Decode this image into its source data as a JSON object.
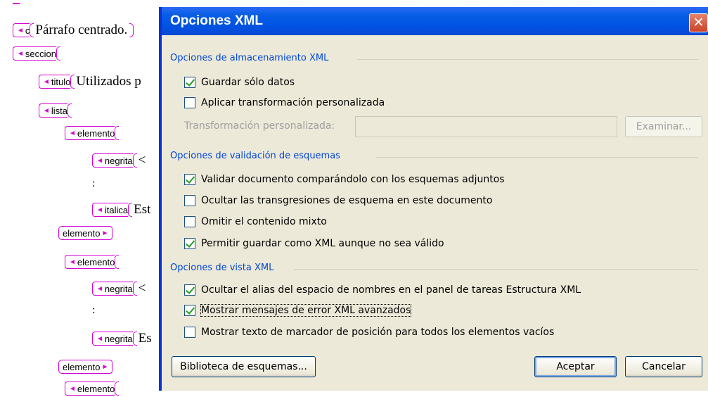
{
  "document": {
    "c_tag": "c",
    "c_text": "Párrafo centrado.",
    "seccion_tag": "seccion",
    "titulo_tag": "titulo",
    "titulo_text": "Utilizados p",
    "lista_tag": "lista",
    "elemento_tag": "elemento",
    "negrita_tag": "negrita",
    "italica_tag": "italica",
    "negrita1_text": "<",
    "italica_text": "Est",
    "negrita2_text": "<",
    "negrita3_text": "Es",
    "colon": ":"
  },
  "dialog": {
    "title": "Opciones XML",
    "close_glyph": "✕",
    "storage": {
      "title": "Opciones de almacenamiento XML",
      "save_data_only": {
        "label": "Guardar sólo datos",
        "checked": true
      },
      "apply_transform": {
        "label": "Aplicar transformación personalizada",
        "checked": false
      },
      "transform_label": "Transformación personalizada:",
      "transform_value": "",
      "browse_label": "Examinar..."
    },
    "validation": {
      "title": "Opciones de validación de esquemas",
      "validate": {
        "label": "Validar documento comparándolo con los esquemas adjuntos",
        "checked": true
      },
      "hide_violations": {
        "label": "Ocultar las transgresiones de esquema en este documento",
        "checked": false
      },
      "ignore_mixed": {
        "label": "Omitir el contenido mixto",
        "checked": false
      },
      "allow_save_invalid": {
        "label": "Permitir guardar como XML aunque no sea válido",
        "checked": true
      }
    },
    "view": {
      "title": "Opciones de vista XML",
      "hide_alias": {
        "label": "Ocultar el alias del espacio de nombres en el panel de tareas Estructura XML",
        "checked": true
      },
      "advanced_errors": {
        "label": "Mostrar mensajes de error XML avanzados",
        "checked": true
      },
      "placeholder_text": {
        "label": "Mostrar texto de marcador de posición para todos los elementos vacíos",
        "checked": false
      }
    },
    "schema_library_label": "Biblioteca de esquemas...",
    "ok_label": "Aceptar",
    "cancel_label": "Cancelar"
  }
}
